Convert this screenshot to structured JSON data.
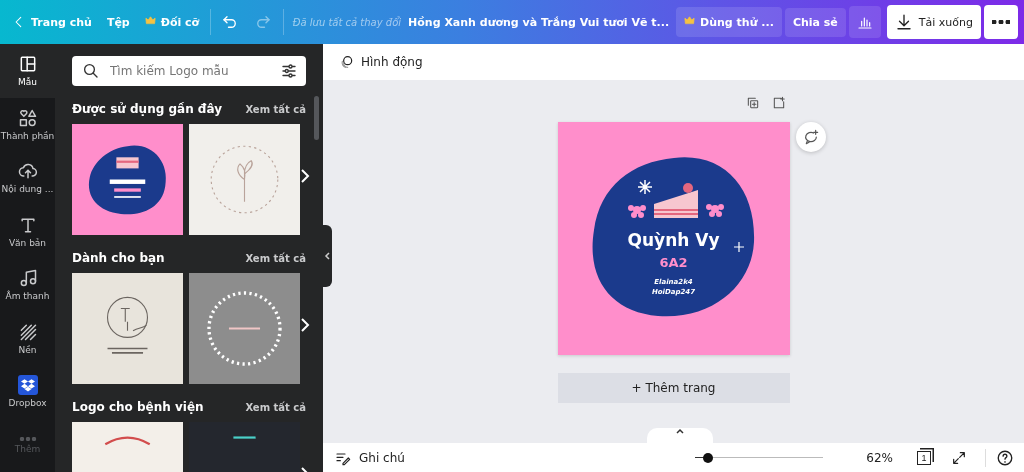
{
  "top_bar": {
    "back": "Trang chủ",
    "file_menu": "Tệp",
    "resize": "Đối cỡ",
    "redo_disabled": true,
    "save_status": "Đã lưu tất cả thay đổi",
    "title": "Hồng Xanh dương và Trắng Vui tươi Vẽ t...",
    "trial": "Dùng thử ...",
    "share": "Chia sẻ",
    "download": "Tải xuống"
  },
  "rail": [
    {
      "label": "Mẫu",
      "kind": "templates",
      "selected": true,
      "disabled": false
    },
    {
      "label": "Thành phần",
      "kind": "elements",
      "selected": false,
      "disabled": false
    },
    {
      "label": "Nội dung ...",
      "kind": "uploads",
      "selected": false,
      "disabled": false
    },
    {
      "label": "Văn bản",
      "kind": "text",
      "selected": false,
      "disabled": false
    },
    {
      "label": "Âm thanh",
      "kind": "audio",
      "selected": false,
      "disabled": false
    },
    {
      "label": "Nền",
      "kind": "background",
      "selected": false,
      "disabled": false
    },
    {
      "label": "Dropbox",
      "kind": "dropbox",
      "selected": false,
      "disabled": false
    },
    {
      "label": "Thêm",
      "kind": "more",
      "selected": false,
      "disabled": true
    }
  ],
  "search": {
    "placeholder": "Tìm kiếm Logo mẫu"
  },
  "sections": [
    {
      "title": "Được sử dụng gần đây",
      "link": "Xem tất cả",
      "thumbs": [
        {
          "kind": "cake"
        },
        {
          "kind": "floral"
        }
      ]
    },
    {
      "title": "Dành cho bạn",
      "link": "Xem tất cả",
      "thumbs": [
        {
          "kind": "monogram"
        },
        {
          "kind": "wreath"
        }
      ]
    },
    {
      "title": "Logo cho bệnh viện",
      "link": "Xem tất cả",
      "thumbs": [
        {
          "kind": "light"
        },
        {
          "kind": "dark"
        }
      ]
    }
  ],
  "toolbar": {
    "animate": "Hình động"
  },
  "design": {
    "name": "Quỳnh Vy",
    "class": "6A2",
    "line_1": "Elaina2k4",
    "line_2": "HoiDap247"
  },
  "add_page": "+ Thêm trang",
  "bottom_bar": {
    "notes": "Ghi chú",
    "zoom": {
      "level": 0.1
    },
    "zoom_reading": "62%",
    "page_count": "1"
  }
}
